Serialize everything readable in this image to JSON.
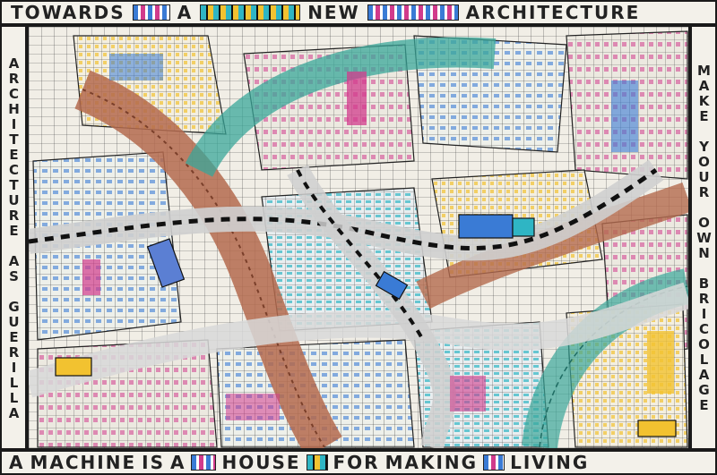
{
  "frame": {
    "top": [
      "TOWARDS",
      "A",
      "NEW",
      "ARCHITECTURE"
    ],
    "right": "MAKE YOUR OWN BRICOLAGE",
    "left": "ARCHITECTURE AS GUERILLA",
    "bottom": [
      "A",
      "MACHINE",
      "IS",
      "A",
      "HOUSE",
      "FOR",
      "MAKING",
      "LIVING"
    ]
  },
  "colors": {
    "ink": "#1a1a1a",
    "road_brown": "#b46a4e",
    "road_teal": "#3aa79a",
    "accent_blue": "#3a7bd5",
    "accent_magenta": "#d13b8c",
    "accent_yellow": "#f2c230",
    "accent_cyan": "#2fb5c4",
    "paper": "#efece4"
  }
}
